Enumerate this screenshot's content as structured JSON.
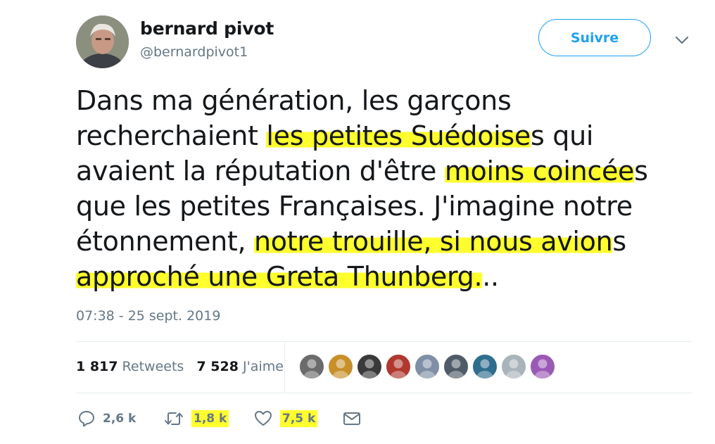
{
  "author": {
    "name": "bernard pivot",
    "handle": "@bernardpivot1"
  },
  "follow_label": "Suivre",
  "tweet": {
    "segments": [
      {
        "text": "Dans ma génération, les garçons recherchaient ",
        "highlight": false
      },
      {
        "text": "les petites Suédoise",
        "highlight": true
      },
      {
        "text": "s qui avaient la réputation d'être ",
        "highlight": false
      },
      {
        "text": "moins coincée",
        "highlight": true
      },
      {
        "text": "s que les petites Françaises. J'imagine notre étonnement, ",
        "highlight": false
      },
      {
        "text": "notre trouille, si nous avion",
        "highlight": true
      },
      {
        "text": "s ",
        "highlight": false
      },
      {
        "text": "approché une Greta Thunberg.",
        "highlight": true
      },
      {
        "text": "..",
        "highlight": false
      }
    ],
    "timestamp": "07:38 - 25 sept. 2019"
  },
  "stats": {
    "retweets_count": "1 817",
    "retweets_label": "Retweets",
    "likes_count": "7 528",
    "likes_label": "J'aime"
  },
  "likers": [
    {
      "name": "liker-1",
      "color": "#6b6b6b"
    },
    {
      "name": "liker-2",
      "color": "#c8902a"
    },
    {
      "name": "liker-3",
      "color": "#3a3a3a"
    },
    {
      "name": "liker-4",
      "color": "#b0382e"
    },
    {
      "name": "liker-5",
      "color": "#7f8fa6"
    },
    {
      "name": "liker-6",
      "color": "#4f5b66"
    },
    {
      "name": "liker-7",
      "color": "#2f6e8e"
    },
    {
      "name": "liker-8",
      "color": "#a9b3ba"
    },
    {
      "name": "liker-9",
      "color": "#9b59b6"
    }
  ],
  "actions": {
    "reply": {
      "icon": "reply-icon",
      "count": "2,6 k"
    },
    "retweet": {
      "icon": "retweet-icon",
      "count": "1,8 k"
    },
    "like": {
      "icon": "heart-icon",
      "count": "7,5 k"
    },
    "message": {
      "icon": "envelope-icon"
    }
  },
  "colors": {
    "accent": "#1da1f2",
    "highlight": "#ffff2e",
    "muted": "#657786",
    "text": "#14171a"
  }
}
